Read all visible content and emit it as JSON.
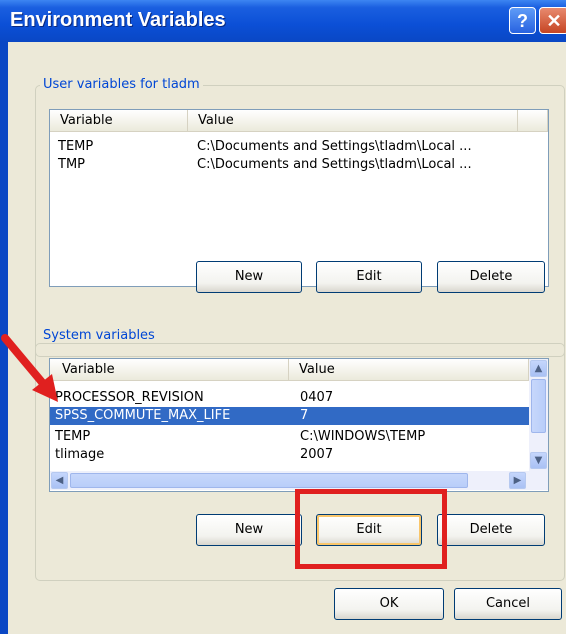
{
  "window": {
    "title": "Environment Variables",
    "help_glyph": "?",
    "close_glyph": "✕"
  },
  "user_vars": {
    "group_label": "User variables for tladm",
    "columns": [
      "Variable",
      "Value"
    ],
    "rows": [
      {
        "variable": "TEMP",
        "value": "C:\\Documents and Settings\\tladm\\Local ..."
      },
      {
        "variable": "TMP",
        "value": "C:\\Documents and Settings\\tladm\\Local ..."
      }
    ],
    "buttons": {
      "new": "New",
      "edit": "Edit",
      "delete": "Delete"
    }
  },
  "system_vars": {
    "group_label": "System variables",
    "columns": [
      "Variable",
      "Value"
    ],
    "rows": [
      {
        "variable": "PROCESSOR_REVISION",
        "value": "0407"
      },
      {
        "variable": "SPSS_COMMUTE_MAX_LIFE",
        "value": "7",
        "selected": true
      },
      {
        "variable": "TEMP",
        "value": "C:\\WINDOWS\\TEMP"
      },
      {
        "variable": "tlimage",
        "value": "2007"
      }
    ],
    "buttons": {
      "new": "New",
      "edit": "Edit",
      "delete": "Delete"
    }
  },
  "dialog_buttons": {
    "ok": "OK",
    "cancel": "Cancel"
  },
  "annotations": {
    "arrow_color": "#e0201f",
    "highlight_color": "#e0201f",
    "selection_color": "#316ac5"
  }
}
